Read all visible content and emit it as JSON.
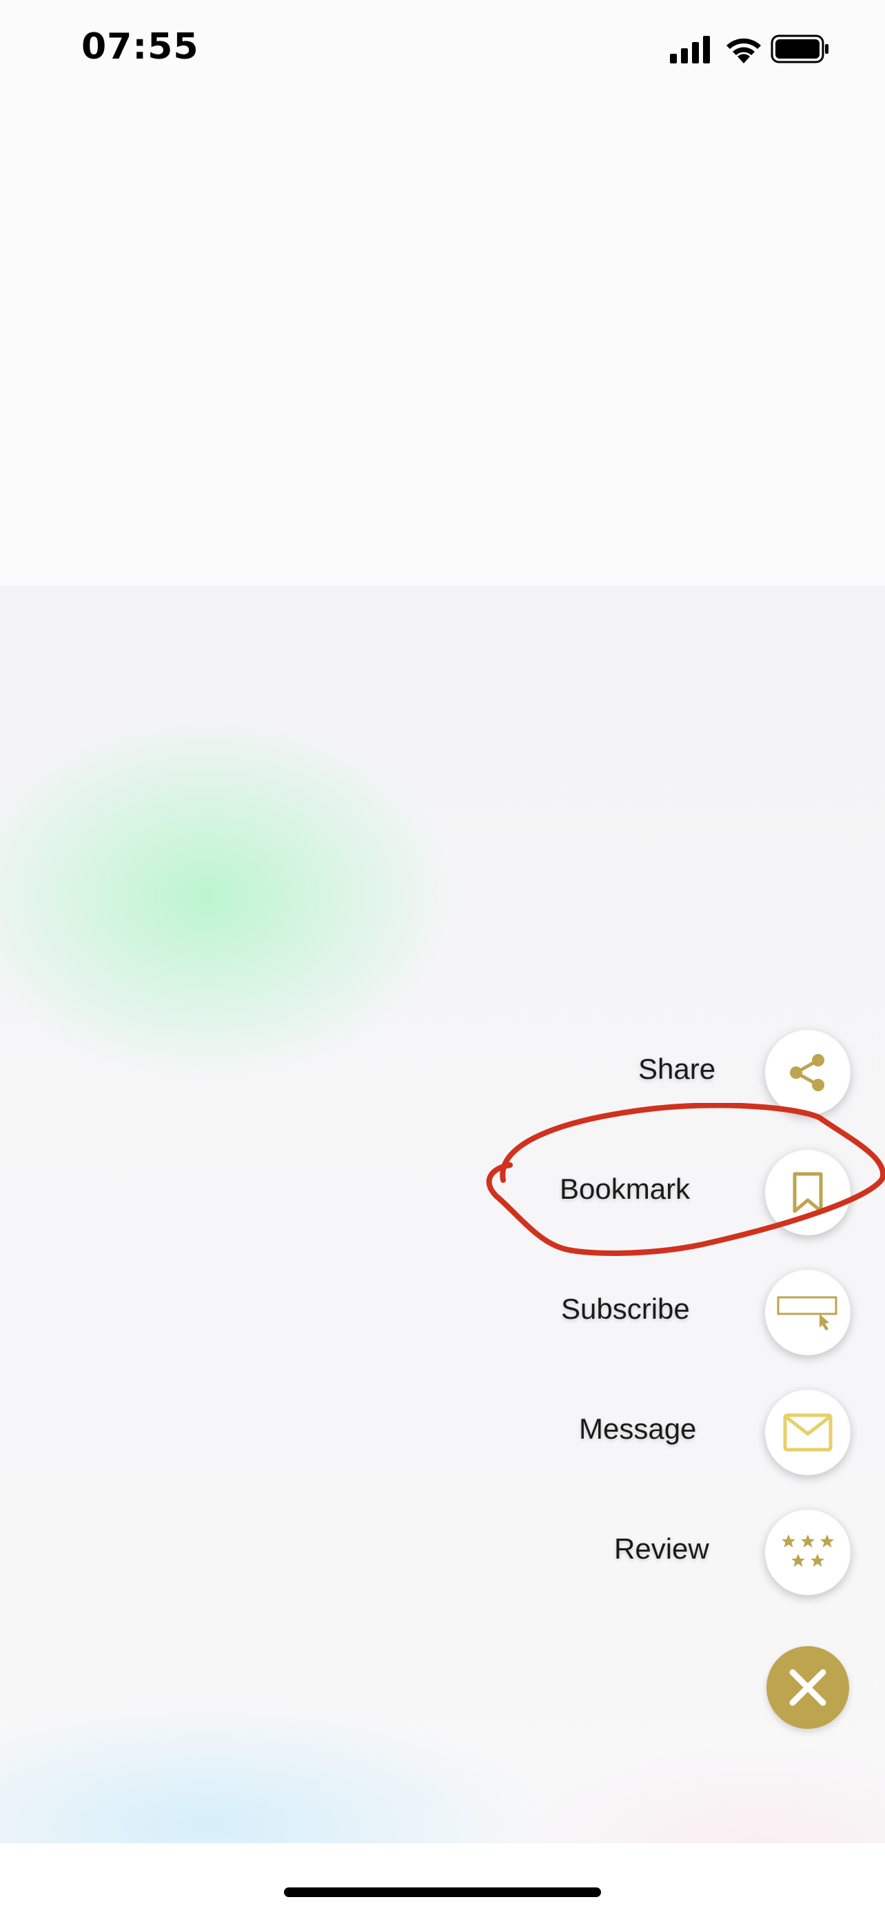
{
  "status_bar": {
    "time": "07:55"
  },
  "actions": [
    {
      "id": "share",
      "label": "Share",
      "icon": "share-icon"
    },
    {
      "id": "bookmark",
      "label": "Bookmark",
      "icon": "bookmark-icon"
    },
    {
      "id": "subscribe",
      "label": "Subscribe",
      "icon": "subscribe-icon"
    },
    {
      "id": "message",
      "label": "Message",
      "icon": "envelope-icon"
    },
    {
      "id": "review",
      "label": "Review",
      "icon": "stars-icon"
    }
  ],
  "close_icon": "close-icon",
  "colors": {
    "accent": "#BDA44E",
    "envelope": "#E8CF6A",
    "annotation": "#D0321E"
  }
}
